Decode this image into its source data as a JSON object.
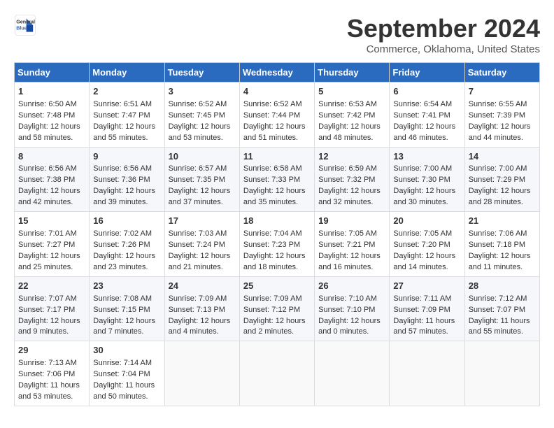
{
  "header": {
    "logo_line1": "General",
    "logo_line2": "Blue",
    "title": "September 2024",
    "subtitle": "Commerce, Oklahoma, United States"
  },
  "days_of_week": [
    "Sunday",
    "Monday",
    "Tuesday",
    "Wednesday",
    "Thursday",
    "Friday",
    "Saturday"
  ],
  "weeks": [
    [
      {
        "day": "1",
        "info": "Sunrise: 6:50 AM\nSunset: 7:48 PM\nDaylight: 12 hours and 58 minutes."
      },
      {
        "day": "2",
        "info": "Sunrise: 6:51 AM\nSunset: 7:47 PM\nDaylight: 12 hours and 55 minutes."
      },
      {
        "day": "3",
        "info": "Sunrise: 6:52 AM\nSunset: 7:45 PM\nDaylight: 12 hours and 53 minutes."
      },
      {
        "day": "4",
        "info": "Sunrise: 6:52 AM\nSunset: 7:44 PM\nDaylight: 12 hours and 51 minutes."
      },
      {
        "day": "5",
        "info": "Sunrise: 6:53 AM\nSunset: 7:42 PM\nDaylight: 12 hours and 48 minutes."
      },
      {
        "day": "6",
        "info": "Sunrise: 6:54 AM\nSunset: 7:41 PM\nDaylight: 12 hours and 46 minutes."
      },
      {
        "day": "7",
        "info": "Sunrise: 6:55 AM\nSunset: 7:39 PM\nDaylight: 12 hours and 44 minutes."
      }
    ],
    [
      {
        "day": "8",
        "info": "Sunrise: 6:56 AM\nSunset: 7:38 PM\nDaylight: 12 hours and 42 minutes."
      },
      {
        "day": "9",
        "info": "Sunrise: 6:56 AM\nSunset: 7:36 PM\nDaylight: 12 hours and 39 minutes."
      },
      {
        "day": "10",
        "info": "Sunrise: 6:57 AM\nSunset: 7:35 PM\nDaylight: 12 hours and 37 minutes."
      },
      {
        "day": "11",
        "info": "Sunrise: 6:58 AM\nSunset: 7:33 PM\nDaylight: 12 hours and 35 minutes."
      },
      {
        "day": "12",
        "info": "Sunrise: 6:59 AM\nSunset: 7:32 PM\nDaylight: 12 hours and 32 minutes."
      },
      {
        "day": "13",
        "info": "Sunrise: 7:00 AM\nSunset: 7:30 PM\nDaylight: 12 hours and 30 minutes."
      },
      {
        "day": "14",
        "info": "Sunrise: 7:00 AM\nSunset: 7:29 PM\nDaylight: 12 hours and 28 minutes."
      }
    ],
    [
      {
        "day": "15",
        "info": "Sunrise: 7:01 AM\nSunset: 7:27 PM\nDaylight: 12 hours and 25 minutes."
      },
      {
        "day": "16",
        "info": "Sunrise: 7:02 AM\nSunset: 7:26 PM\nDaylight: 12 hours and 23 minutes."
      },
      {
        "day": "17",
        "info": "Sunrise: 7:03 AM\nSunset: 7:24 PM\nDaylight: 12 hours and 21 minutes."
      },
      {
        "day": "18",
        "info": "Sunrise: 7:04 AM\nSunset: 7:23 PM\nDaylight: 12 hours and 18 minutes."
      },
      {
        "day": "19",
        "info": "Sunrise: 7:05 AM\nSunset: 7:21 PM\nDaylight: 12 hours and 16 minutes."
      },
      {
        "day": "20",
        "info": "Sunrise: 7:05 AM\nSunset: 7:20 PM\nDaylight: 12 hours and 14 minutes."
      },
      {
        "day": "21",
        "info": "Sunrise: 7:06 AM\nSunset: 7:18 PM\nDaylight: 12 hours and 11 minutes."
      }
    ],
    [
      {
        "day": "22",
        "info": "Sunrise: 7:07 AM\nSunset: 7:17 PM\nDaylight: 12 hours and 9 minutes."
      },
      {
        "day": "23",
        "info": "Sunrise: 7:08 AM\nSunset: 7:15 PM\nDaylight: 12 hours and 7 minutes."
      },
      {
        "day": "24",
        "info": "Sunrise: 7:09 AM\nSunset: 7:13 PM\nDaylight: 12 hours and 4 minutes."
      },
      {
        "day": "25",
        "info": "Sunrise: 7:09 AM\nSunset: 7:12 PM\nDaylight: 12 hours and 2 minutes."
      },
      {
        "day": "26",
        "info": "Sunrise: 7:10 AM\nSunset: 7:10 PM\nDaylight: 12 hours and 0 minutes."
      },
      {
        "day": "27",
        "info": "Sunrise: 7:11 AM\nSunset: 7:09 PM\nDaylight: 11 hours and 57 minutes."
      },
      {
        "day": "28",
        "info": "Sunrise: 7:12 AM\nSunset: 7:07 PM\nDaylight: 11 hours and 55 minutes."
      }
    ],
    [
      {
        "day": "29",
        "info": "Sunrise: 7:13 AM\nSunset: 7:06 PM\nDaylight: 11 hours and 53 minutes."
      },
      {
        "day": "30",
        "info": "Sunrise: 7:14 AM\nSunset: 7:04 PM\nDaylight: 11 hours and 50 minutes."
      },
      {
        "day": "",
        "info": ""
      },
      {
        "day": "",
        "info": ""
      },
      {
        "day": "",
        "info": ""
      },
      {
        "day": "",
        "info": ""
      },
      {
        "day": "",
        "info": ""
      }
    ]
  ]
}
